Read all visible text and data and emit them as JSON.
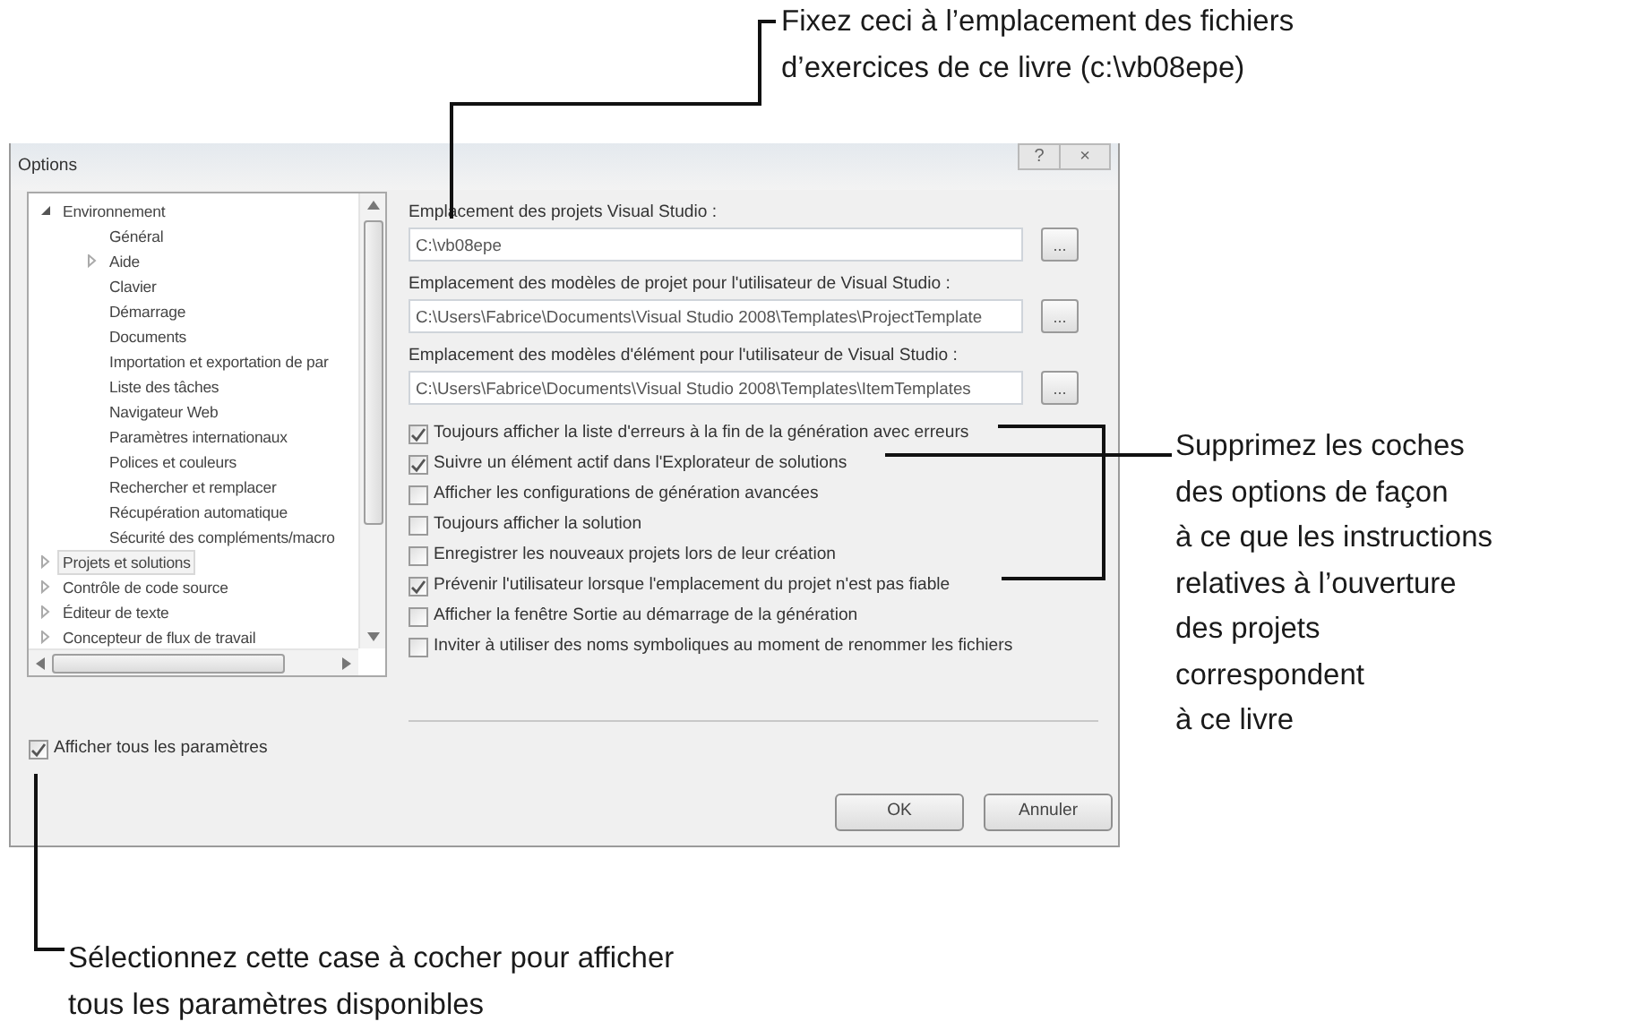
{
  "callouts": [
    {
      "kind": "top",
      "lines": [
        "Fixez ceci à l’emplacement des fichiers",
        "d’exercices de ce livre (c:\\vb08epe)"
      ]
    },
    {
      "kind": "right",
      "lines": [
        "Supprimez les coches",
        "des options de façon",
        "à ce que les instructions",
        "relatives à l’ouverture",
        "des projets",
        "correspondent",
        "à ce livre"
      ]
    },
    {
      "kind": "bottom",
      "lines": [
        "Sélectionnez cette case à cocher pour afficher",
        "tous les paramètres disponibles"
      ]
    }
  ],
  "window": {
    "title": "Options",
    "title_buttons": [
      "?",
      "×"
    ]
  },
  "tree": [
    {
      "label": "Environnement",
      "expanded": true,
      "selected": false,
      "children": [
        {
          "label": "Général",
          "selected": false
        },
        {
          "label": "Aide",
          "expanded": false,
          "selected": false
        },
        {
          "label": "Clavier",
          "selected": false
        },
        {
          "label": "Démarrage",
          "selected": false
        },
        {
          "label": "Documents",
          "selected": false
        },
        {
          "label": "Importation et exportation de par",
          "selected": false
        },
        {
          "label": "Liste des tâches",
          "selected": false
        },
        {
          "label": "Navigateur Web",
          "selected": false
        },
        {
          "label": "Paramètres internationaux",
          "selected": false
        },
        {
          "label": "Polices et couleurs",
          "selected": false
        },
        {
          "label": "Rechercher et remplacer",
          "selected": false
        },
        {
          "label": "Récupération automatique",
          "selected": false
        },
        {
          "label": "Sécurité des compléments/macro",
          "selected": false
        }
      ]
    },
    {
      "label": "Projets et solutions",
      "expanded": false,
      "selected": true
    },
    {
      "label": "Contrôle de code source",
      "expanded": false,
      "selected": false
    },
    {
      "label": "Éditeur de texte",
      "expanded": false,
      "selected": false
    },
    {
      "label": "Concepteur de flux de travail",
      "expanded": false,
      "selected": false
    }
  ],
  "fields": [
    {
      "label": "Emplacement des projets Visual Studio :",
      "value": "C:\\vb08epe",
      "button": "..."
    },
    {
      "label": "Emplacement des modèles de projet pour l'utilisateur de Visual Studio :",
      "value": "C:\\Users\\Fabrice\\Documents\\Visual Studio 2008\\Templates\\ProjectTemplate",
      "button": "..."
    },
    {
      "label": "Emplacement des modèles d'élément pour l'utilisateur de Visual Studio :",
      "value": "C:\\Users\\Fabrice\\Documents\\Visual Studio 2008\\Templates\\ItemTemplates",
      "button": "..."
    }
  ],
  "options": [
    {
      "label": "Toujours afficher la liste d'erreurs à la fin de la génération avec erreurs",
      "checked": true
    },
    {
      "label": "Suivre un élément actif dans l'Explorateur de solutions",
      "checked": true
    },
    {
      "label": "Afficher les configurations de génération avancées",
      "checked": false
    },
    {
      "label": "Toujours afficher la solution",
      "checked": false
    },
    {
      "label": "Enregistrer les nouveaux projets lors de leur création",
      "checked": false
    },
    {
      "label": "Prévenir l'utilisateur lorsque l'emplacement du projet n'est pas fiable",
      "checked": true
    },
    {
      "label": "Afficher la fenêtre Sortie au démarrage de la génération",
      "checked": false
    },
    {
      "label": "Inviter à utiliser des noms symboliques au moment de renommer les fichiers",
      "checked": false
    }
  ],
  "show_all": {
    "label": "Afficher tous les paramètres",
    "checked": true
  },
  "buttons": [
    "OK",
    "Annuler"
  ]
}
